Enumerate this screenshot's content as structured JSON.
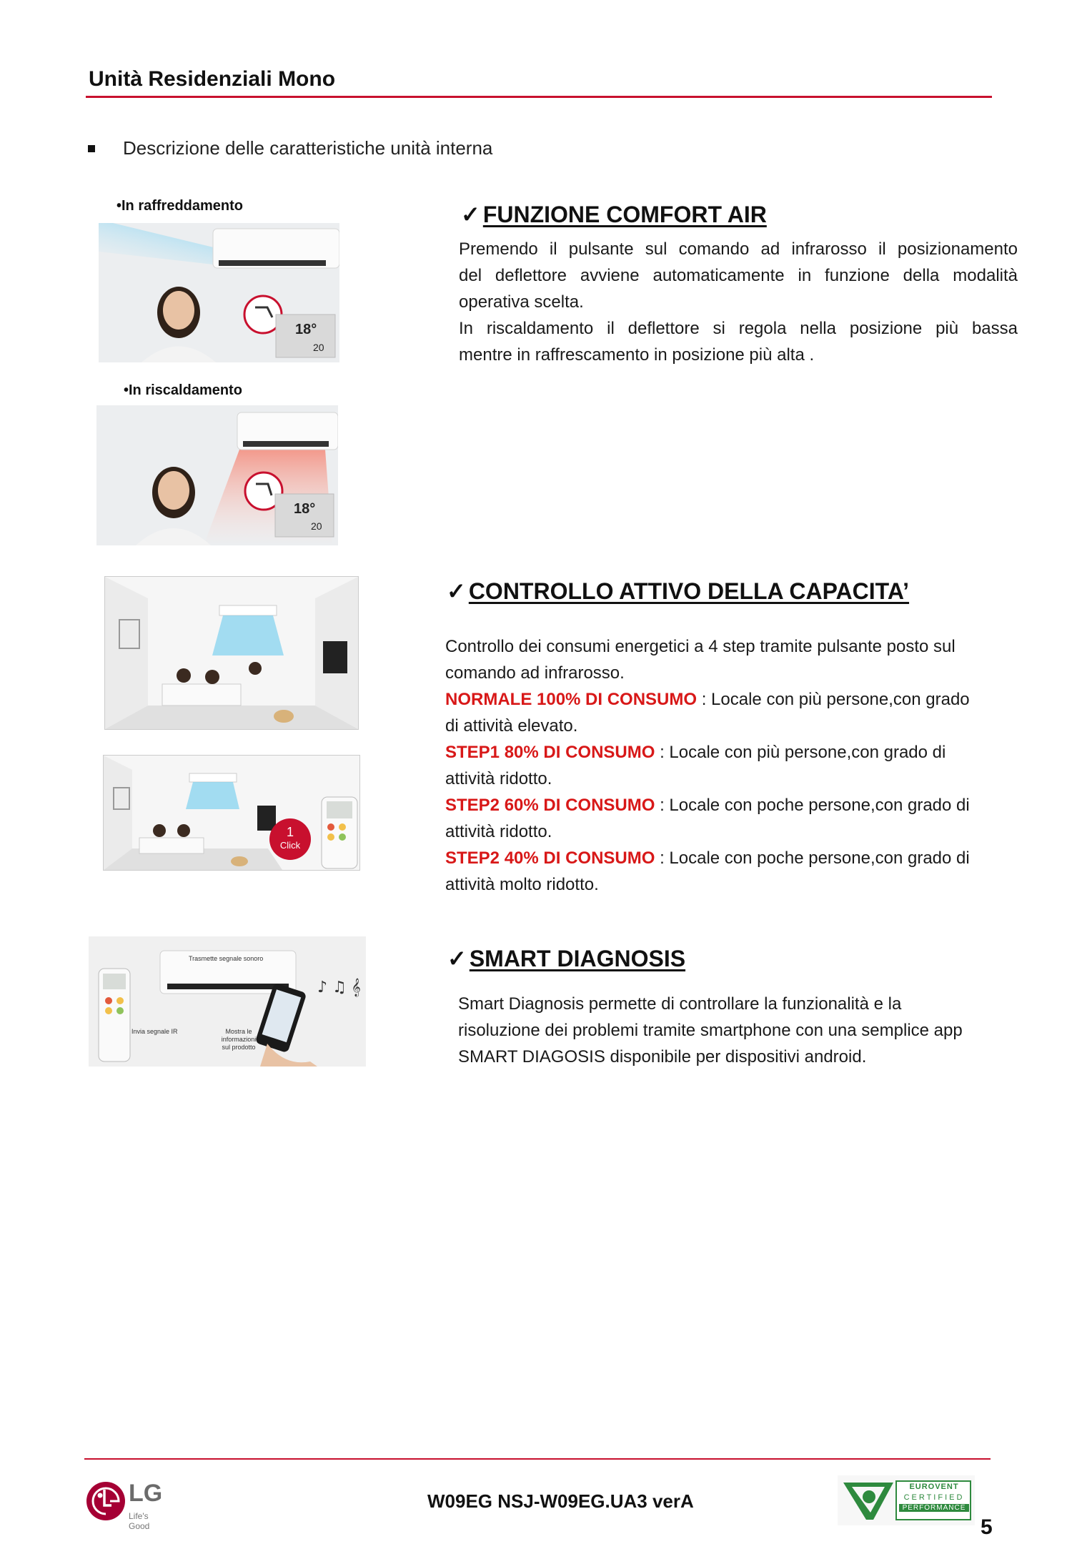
{
  "header": {
    "title": "Unità Residenziali Mono",
    "bullet": "Descrizione delle caratteristiche unità interna"
  },
  "images": {
    "cooling_caption": "•In raffreddamento",
    "heating_caption": "•In riscaldamento",
    "display_reading": "18°",
    "display_reading_small": "20",
    "click_number": "1",
    "click_label": "Click",
    "step1_label": "Invia segnale IR",
    "step2_label": "Trasmette segnale sonoro",
    "step3_label": "Mostra le informazioni sul prodotto"
  },
  "comfort_air": {
    "check": "✓",
    "title": "FUNZIONE COMFORT AIR",
    "lines": [
      "Premendo il pulsante sul comando ad infrarosso il posizionamento",
      "del deflettore avviene automaticamente in funzione della modalità",
      "operativa scelta.",
      "In riscaldamento il  deflettore si regola nella posizione più bassa",
      "mentre in raffrescamento in posizione più alta ."
    ]
  },
  "capacity": {
    "check": "✓",
    "title": "CONTROLLO ATTIVO DELLA CAPACITA’",
    "intro_1": "Controllo dei consumi energetici a 4 step tramite pulsante posto sul",
    "intro_2": "comando ad infrarosso.",
    "items": [
      {
        "label": "NORMALE 100% DI CONSUMO",
        "text": " : Locale con più persone,con grado",
        "cont": "di attività elevato."
      },
      {
        "label": "STEP1 80% DI CONSUMO",
        "text": " : Locale con più persone,con grado di",
        "cont": "attività ridotto."
      },
      {
        "label": "STEP2 60% DI CONSUMO",
        "text": " : Locale con poche persone,con grado di",
        "cont": "attività ridotto."
      },
      {
        "label": "STEP2 40% DI CONSUMO",
        "text": " : Locale con poche persone,con grado di",
        "cont": "attività molto  ridotto."
      }
    ]
  },
  "smart": {
    "check": "✓",
    "title": "SMART DIAGNOSIS",
    "lines": [
      "Smart Diagnosis permette di controllare la funzionalità e la",
      "risoluzione dei problemi tramite smartphone con una semplice app",
      "SMART DIAGOSIS disponibile per dispositivi android."
    ]
  },
  "footer": {
    "model": "W09EG NSJ-W09EG.UA3  verA",
    "page": "5",
    "brand": "LG",
    "tagline": "Life's Good",
    "cert_line1": "EUROVENT",
    "cert_line2": "CERTIFIED",
    "cert_line3": "PERFORMANCE"
  },
  "colors": {
    "accent": "#c8102e",
    "highlight_red": "#d81818",
    "lg_red": "#a50034",
    "cert_green": "#2e8a3e"
  }
}
